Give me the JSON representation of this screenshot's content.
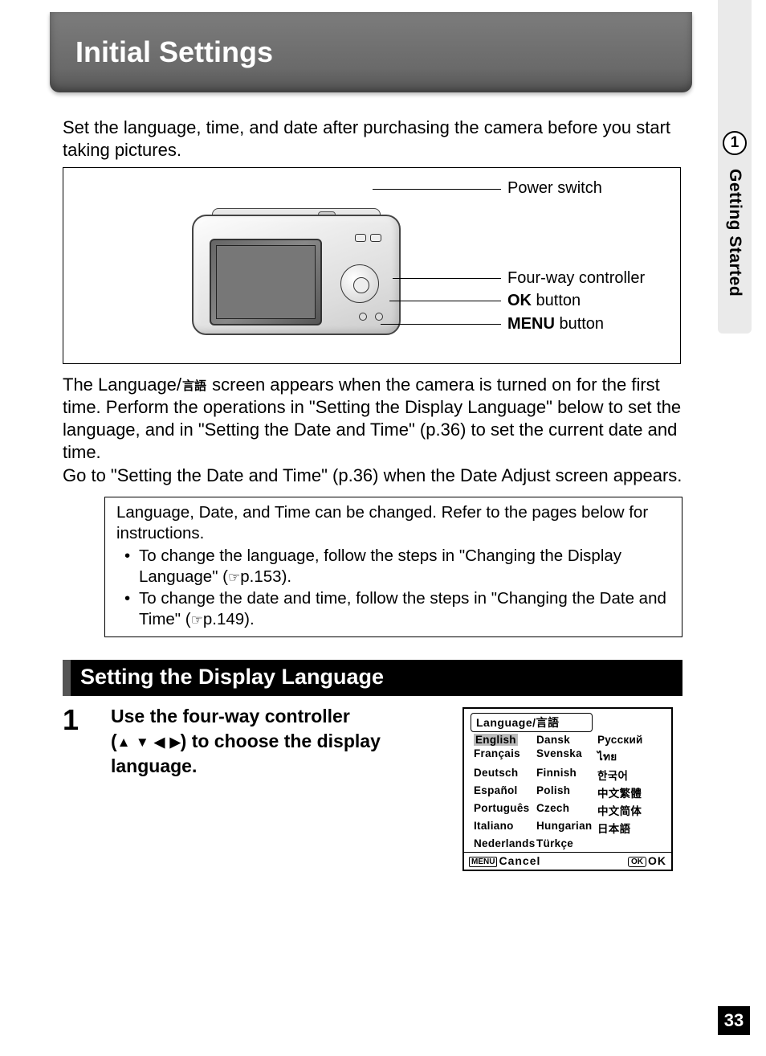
{
  "tab": {
    "number": "1",
    "label": "Getting Started"
  },
  "title": "Initial Settings",
  "intro": "Set the language, time, and date after purchasing the camera before you start taking pictures.",
  "diagram_labels": {
    "power_switch": "Power switch",
    "four_way": "Four-way controller",
    "ok_prefix": "OK",
    "ok_suffix": " button",
    "menu_prefix": "MENU",
    "menu_suffix": " button"
  },
  "body1_a": "The ",
  "body1_b": "Language/",
  "body1_lang_icon": "言語",
  "body1_c": " screen appears when the camera is turned on for the first time. Perform the operations in \"Setting the Display Language\" below to set the language, and in \"Setting the Date and Time\" (p.36) to set the current date and time.",
  "body2": "Go to \"Setting the Date and Time\" (p.36) when the Date Adjust screen appears.",
  "note": {
    "lead": "Language, Date, and Time can be changed. Refer to the pages below for instructions.",
    "item1_a": "To change the language, follow the steps in \"Changing the Display Language\" (",
    "item1_b": "p.153).",
    "item2_a": "To change the date and time, follow the steps in \"Changing the Date and Time\" (",
    "item2_b": "p.149)."
  },
  "section_heading": "Setting the Display Language",
  "step1": {
    "num": "1",
    "line1": "Use the four-way controller",
    "line2_a": "(",
    "line2_b": ") to choose the display",
    "line3": "language."
  },
  "lang_screen": {
    "title": "Language/言語",
    "col1": [
      "English",
      "Français",
      "Deutsch",
      "Español",
      "Português",
      "Italiano",
      "Nederlands"
    ],
    "col2": [
      "Dansk",
      "Svenska",
      "Finnish",
      "Polish",
      "Czech",
      "Hungarian",
      "Türkçe"
    ],
    "col3": [
      "Русский",
      "ไทย",
      "한국어",
      "中文繁體",
      "中文简体",
      "日本語",
      ""
    ],
    "menu_label": "MENU",
    "cancel": "Cancel",
    "ok_label": "OK",
    "ok": "OK"
  },
  "page_number": "33"
}
